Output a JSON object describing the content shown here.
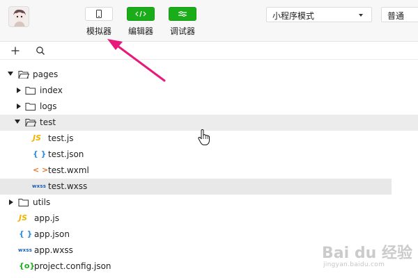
{
  "toolbar": {
    "simulator_label": "模拟器",
    "editor_label": "编辑器",
    "debugger_label": "调试器",
    "mode_select_value": "小程序模式",
    "compile_select_value": "普通"
  },
  "icons": {
    "add": "plus-icon",
    "search": "search-icon",
    "folder": "folder-icon"
  },
  "colors": {
    "green_button": "#1aad19",
    "annotation_arrow": "#e8197a",
    "js_icon": "#f0b400",
    "json_icon": "#2b8ce3",
    "wxml_icon": "#e6762b",
    "wxss_icon": "#1a5fb4"
  },
  "tree": {
    "items": [
      {
        "label": "pages"
      },
      {
        "label": "index"
      },
      {
        "label": "logs"
      },
      {
        "label": "test"
      },
      {
        "label": "test.js",
        "icon_text": "JS"
      },
      {
        "label": "test.json",
        "icon_text": "{ }"
      },
      {
        "label": "test.wxml",
        "icon_text": "< >"
      },
      {
        "label": "test.wxss",
        "icon_text": "wxss"
      },
      {
        "label": "utils"
      },
      {
        "label": "app.js",
        "icon_text": "JS"
      },
      {
        "label": "app.json",
        "icon_text": "{ }"
      },
      {
        "label": "app.wxss",
        "icon_text": "wxss"
      },
      {
        "label": "project.config.json",
        "icon_text": "{o}"
      }
    ]
  },
  "watermark": {
    "brand": "Bai du 经验",
    "url": "jingyan.baidu.com"
  }
}
